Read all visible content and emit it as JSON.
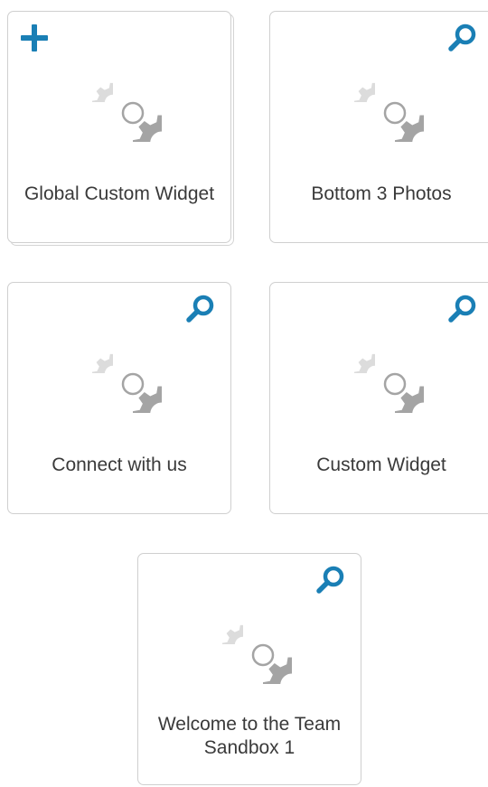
{
  "widgets": [
    {
      "title": "Global Custom Widget",
      "action_icon": "plus-icon",
      "icon": "gears-icon",
      "stacked": true
    },
    {
      "title": "Bottom 3 Photos",
      "action_icon": "search-icon",
      "icon": "gears-icon"
    },
    {
      "title": "Connect with us",
      "action_icon": "search-icon",
      "icon": "gears-icon"
    },
    {
      "title": "Custom Widget",
      "action_icon": "search-icon",
      "icon": "gears-icon"
    },
    {
      "title": "Welcome to the Team Sandbox 1",
      "action_icon": "search-icon",
      "icon": "gears-icon"
    }
  ],
  "colors": {
    "accent": "#1a7fb5",
    "gear_light": "#dcdcdc",
    "gear_dark": "#a4a4a4",
    "card_border": "#cfcfcf",
    "text": "#3a3a3a"
  }
}
